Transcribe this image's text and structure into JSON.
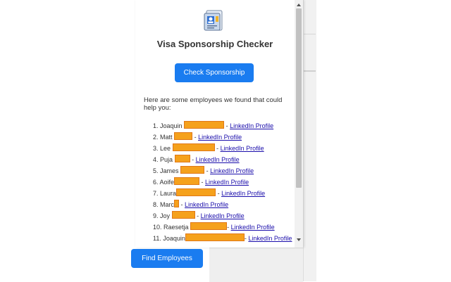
{
  "app": {
    "title": "Visa Sponsorship Checker",
    "logo_icon": "passport-visa-icon",
    "check_button_label": "Check Sponsorship",
    "intro_text": "Here are some employees we found that could help you:",
    "find_button_label": "Find Employees"
  },
  "employees": [
    {
      "number": "1.",
      "name": "Joaquin",
      "link": "LinkedIn Profile"
    },
    {
      "number": "2.",
      "name": "Matt",
      "link": "LinkedIn Profile"
    },
    {
      "number": "3.",
      "name": "Lee",
      "link": "LinkedIn Profile"
    },
    {
      "number": "4.",
      "name": "Puja",
      "link": "LinkedIn Profile"
    },
    {
      "number": "5.",
      "name": "James",
      "link": "LinkedIn Profile"
    },
    {
      "number": "6.",
      "name": "Aoife",
      "link": "LinkedIn Profile"
    },
    {
      "number": "7.",
      "name": "Laura",
      "link": "LinkedIn Profile"
    },
    {
      "number": "8.",
      "name": "Marc",
      "link": "LinkedIn Profile"
    },
    {
      "number": "9.",
      "name": "Joy",
      "link": "LinkedIn Profile"
    },
    {
      "number": "10.",
      "name": "Raesetja",
      "link": "LinkedIn Profile"
    },
    {
      "number": "11.",
      "name": "Joaquin",
      "link": "LinkedIn Profile"
    }
  ],
  "colors": {
    "accent": "#1a7cf0",
    "link": "#1a0dab",
    "redaction": "#f5a11c"
  }
}
